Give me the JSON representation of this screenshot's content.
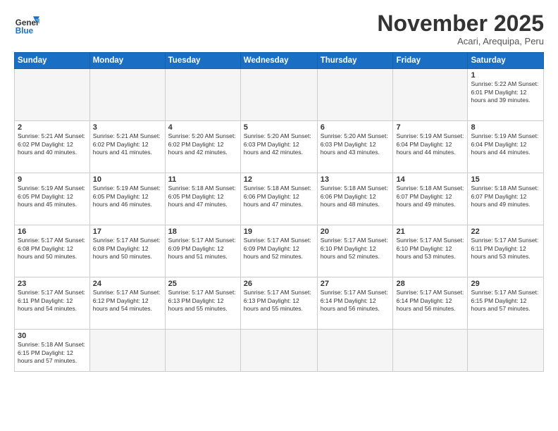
{
  "logo": {
    "text_general": "General",
    "text_blue": "Blue"
  },
  "header": {
    "month_year": "November 2025",
    "location": "Acari, Arequipa, Peru"
  },
  "days_of_week": [
    "Sunday",
    "Monday",
    "Tuesday",
    "Wednesday",
    "Thursday",
    "Friday",
    "Saturday"
  ],
  "weeks": [
    [
      {
        "day": "",
        "info": ""
      },
      {
        "day": "",
        "info": ""
      },
      {
        "day": "",
        "info": ""
      },
      {
        "day": "",
        "info": ""
      },
      {
        "day": "",
        "info": ""
      },
      {
        "day": "",
        "info": ""
      },
      {
        "day": "1",
        "info": "Sunrise: 5:22 AM\nSunset: 6:01 PM\nDaylight: 12 hours and 39 minutes."
      }
    ],
    [
      {
        "day": "2",
        "info": "Sunrise: 5:21 AM\nSunset: 6:02 PM\nDaylight: 12 hours and 40 minutes."
      },
      {
        "day": "3",
        "info": "Sunrise: 5:21 AM\nSunset: 6:02 PM\nDaylight: 12 hours and 41 minutes."
      },
      {
        "day": "4",
        "info": "Sunrise: 5:20 AM\nSunset: 6:02 PM\nDaylight: 12 hours and 42 minutes."
      },
      {
        "day": "5",
        "info": "Sunrise: 5:20 AM\nSunset: 6:03 PM\nDaylight: 12 hours and 42 minutes."
      },
      {
        "day": "6",
        "info": "Sunrise: 5:20 AM\nSunset: 6:03 PM\nDaylight: 12 hours and 43 minutes."
      },
      {
        "day": "7",
        "info": "Sunrise: 5:19 AM\nSunset: 6:04 PM\nDaylight: 12 hours and 44 minutes."
      },
      {
        "day": "8",
        "info": "Sunrise: 5:19 AM\nSunset: 6:04 PM\nDaylight: 12 hours and 44 minutes."
      }
    ],
    [
      {
        "day": "9",
        "info": "Sunrise: 5:19 AM\nSunset: 6:05 PM\nDaylight: 12 hours and 45 minutes."
      },
      {
        "day": "10",
        "info": "Sunrise: 5:19 AM\nSunset: 6:05 PM\nDaylight: 12 hours and 46 minutes."
      },
      {
        "day": "11",
        "info": "Sunrise: 5:18 AM\nSunset: 6:05 PM\nDaylight: 12 hours and 47 minutes."
      },
      {
        "day": "12",
        "info": "Sunrise: 5:18 AM\nSunset: 6:06 PM\nDaylight: 12 hours and 47 minutes."
      },
      {
        "day": "13",
        "info": "Sunrise: 5:18 AM\nSunset: 6:06 PM\nDaylight: 12 hours and 48 minutes."
      },
      {
        "day": "14",
        "info": "Sunrise: 5:18 AM\nSunset: 6:07 PM\nDaylight: 12 hours and 49 minutes."
      },
      {
        "day": "15",
        "info": "Sunrise: 5:18 AM\nSunset: 6:07 PM\nDaylight: 12 hours and 49 minutes."
      }
    ],
    [
      {
        "day": "16",
        "info": "Sunrise: 5:17 AM\nSunset: 6:08 PM\nDaylight: 12 hours and 50 minutes."
      },
      {
        "day": "17",
        "info": "Sunrise: 5:17 AM\nSunset: 6:08 PM\nDaylight: 12 hours and 50 minutes."
      },
      {
        "day": "18",
        "info": "Sunrise: 5:17 AM\nSunset: 6:09 PM\nDaylight: 12 hours and 51 minutes."
      },
      {
        "day": "19",
        "info": "Sunrise: 5:17 AM\nSunset: 6:09 PM\nDaylight: 12 hours and 52 minutes."
      },
      {
        "day": "20",
        "info": "Sunrise: 5:17 AM\nSunset: 6:10 PM\nDaylight: 12 hours and 52 minutes."
      },
      {
        "day": "21",
        "info": "Sunrise: 5:17 AM\nSunset: 6:10 PM\nDaylight: 12 hours and 53 minutes."
      },
      {
        "day": "22",
        "info": "Sunrise: 5:17 AM\nSunset: 6:11 PM\nDaylight: 12 hours and 53 minutes."
      }
    ],
    [
      {
        "day": "23",
        "info": "Sunrise: 5:17 AM\nSunset: 6:11 PM\nDaylight: 12 hours and 54 minutes."
      },
      {
        "day": "24",
        "info": "Sunrise: 5:17 AM\nSunset: 6:12 PM\nDaylight: 12 hours and 54 minutes."
      },
      {
        "day": "25",
        "info": "Sunrise: 5:17 AM\nSunset: 6:13 PM\nDaylight: 12 hours and 55 minutes."
      },
      {
        "day": "26",
        "info": "Sunrise: 5:17 AM\nSunset: 6:13 PM\nDaylight: 12 hours and 55 minutes."
      },
      {
        "day": "27",
        "info": "Sunrise: 5:17 AM\nSunset: 6:14 PM\nDaylight: 12 hours and 56 minutes."
      },
      {
        "day": "28",
        "info": "Sunrise: 5:17 AM\nSunset: 6:14 PM\nDaylight: 12 hours and 56 minutes."
      },
      {
        "day": "29",
        "info": "Sunrise: 5:17 AM\nSunset: 6:15 PM\nDaylight: 12 hours and 57 minutes."
      }
    ],
    [
      {
        "day": "30",
        "info": "Sunrise: 5:18 AM\nSunset: 6:15 PM\nDaylight: 12 hours and 57 minutes."
      },
      {
        "day": "",
        "info": ""
      },
      {
        "day": "",
        "info": ""
      },
      {
        "day": "",
        "info": ""
      },
      {
        "day": "",
        "info": ""
      },
      {
        "day": "",
        "info": ""
      },
      {
        "day": "",
        "info": ""
      }
    ]
  ]
}
